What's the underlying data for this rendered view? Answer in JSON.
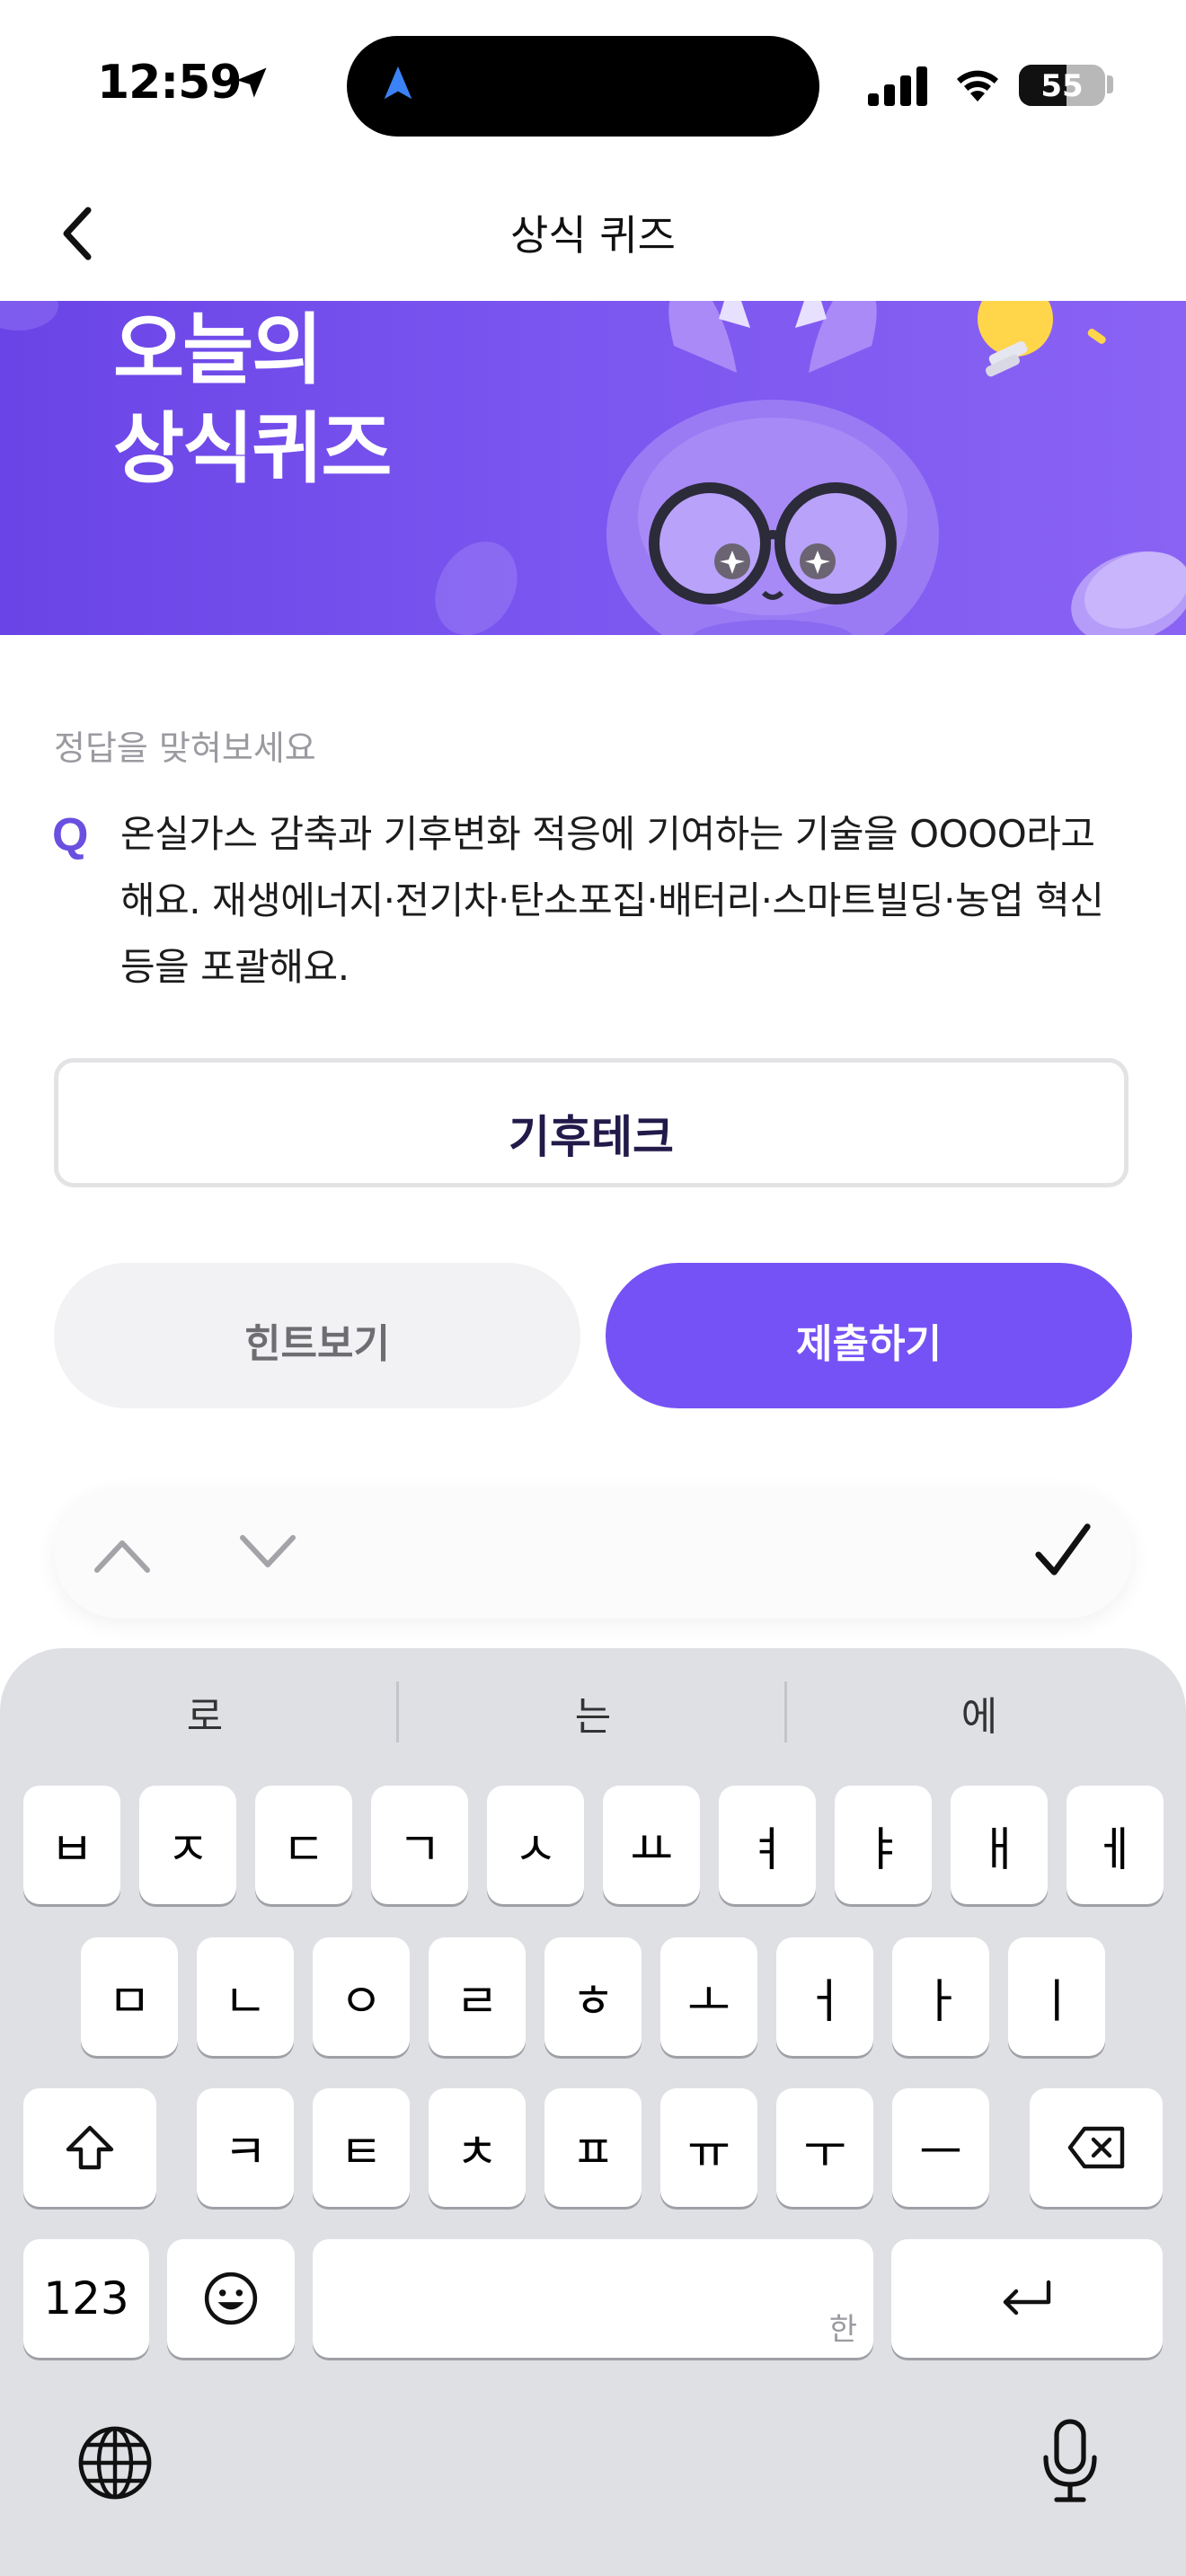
{
  "status_bar": {
    "time": "12:59",
    "battery": "55",
    "battery_level": 0.55
  },
  "nav": {
    "title": "상식 퀴즈"
  },
  "banner": {
    "line1": "오늘의",
    "line2": "상식퀴즈"
  },
  "quiz": {
    "prompt": "정답을 맞혀보세요",
    "q_marker": "Q",
    "question": "온실가스 감축과 기후변화 적응에 기여하는 기술을 OOOO라고 해요. 재생에너지·전기차·탄소포집·배터리·스마트빌딩·농업 혁신 등을 포괄해요.",
    "answer_value": "기후테크"
  },
  "buttons": {
    "hint": "힌트보기",
    "submit": "제출하기"
  },
  "keyboard": {
    "suggestions": [
      "로",
      "는",
      "에"
    ],
    "row1": [
      "ㅂ",
      "ㅈ",
      "ㄷ",
      "ㄱ",
      "ㅅ",
      "ㅛ",
      "ㅕ",
      "ㅑ",
      "ㅐ",
      "ㅔ"
    ],
    "row2": [
      "ㅁ",
      "ㄴ",
      "ㅇ",
      "ㄹ",
      "ㅎ",
      "ㅗ",
      "ㅓ",
      "ㅏ",
      "ㅣ"
    ],
    "row3": [
      "ㅋ",
      "ㅌ",
      "ㅊ",
      "ㅍ",
      "ㅠ",
      "ㅜ",
      "ㅡ"
    ],
    "numbers_key": "123",
    "space_hint": "한"
  }
}
